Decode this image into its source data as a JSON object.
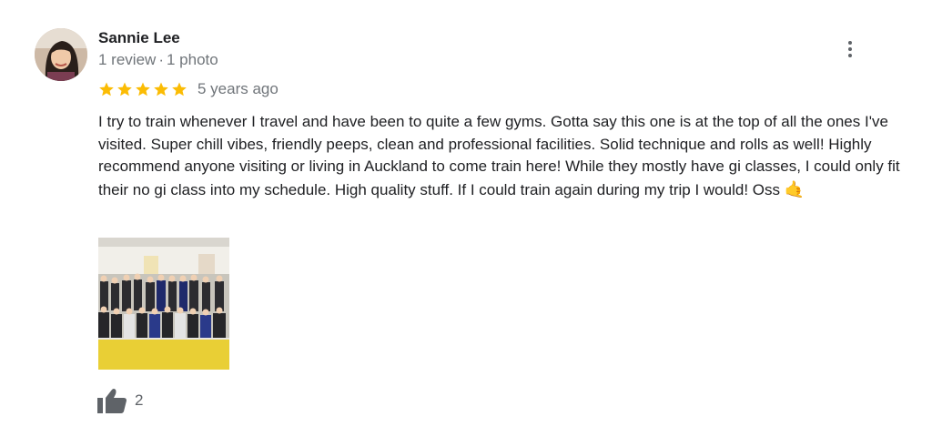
{
  "review": {
    "author": "Sannie Lee",
    "meta": {
      "reviews": "1 review",
      "separator": "·",
      "photos": "1 photo"
    },
    "rating": 5,
    "age": "5 years ago",
    "text": "I try to train whenever I travel and have been to quite a few gyms. Gotta say this one is at the top of all the ones I've visited. Super chill vibes, friendly peeps, clean and professional facilities. Solid technique and rolls as well! Highly recommend anyone visiting or living in Auckland to come train here! While they mostly have gi classes, I could only fit their no gi class into my schedule. High quality stuff. If I could train again during my trip I would! Oss",
    "emoji": "🤙",
    "likes": "2"
  },
  "colors": {
    "star": "#fbbc04",
    "secondary_text": "#70757a",
    "icon": "#5f6368",
    "mat_yellow": "#e9cf35"
  },
  "icons": {
    "menu": "more-vert-icon",
    "like": "thumb-up-icon",
    "star": "star-icon"
  }
}
